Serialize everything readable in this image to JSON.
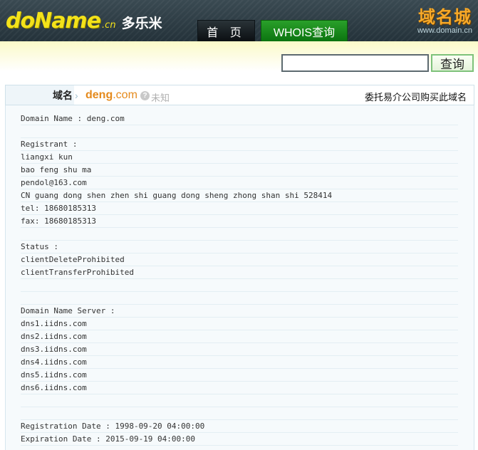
{
  "header": {
    "logo_main": "doName",
    "logo_suffix": ".cn",
    "logo_cn": "多乐米",
    "nav": {
      "home": "首 页",
      "whois": "WHOIS查询"
    },
    "watermark_cn": "域名城",
    "watermark_sub": "www.domain.cn"
  },
  "search": {
    "value": "",
    "placeholder": "",
    "button": "查询"
  },
  "domain_bar": {
    "label": "域名",
    "name": "deng",
    "tld": ".com",
    "status": "未知",
    "buy_link": "委托易介公司购买此域名"
  },
  "whois": {
    "lines": [
      "Domain Name : deng.com",
      "",
      "Registrant :",
      "liangxi kun",
      "bao feng shu ma",
      "pendol@163.com",
      "CN guang dong shen zhen shi guang dong sheng zhong shan shi 528414",
      "tel: 18680185313",
      "fax: 18680185313",
      "",
      "Status :",
      "clientDeleteProhibited",
      "clientTransferProhibited",
      "",
      "",
      "Domain Name Server :",
      "dns1.iidns.com",
      "dns2.iidns.com",
      "dns3.iidns.com",
      "dns4.iidns.com",
      "dns5.iidns.com",
      "dns6.iidns.com",
      "",
      "",
      "Registration Date : 1998-09-20 04:00:00",
      "Expiration Date : 2015-09-19 04:00:00"
    ]
  },
  "colors": {
    "accent_green": "#0b7410",
    "domain_orange": "#e58a1c",
    "logo_yellow": "#f3e21a"
  }
}
